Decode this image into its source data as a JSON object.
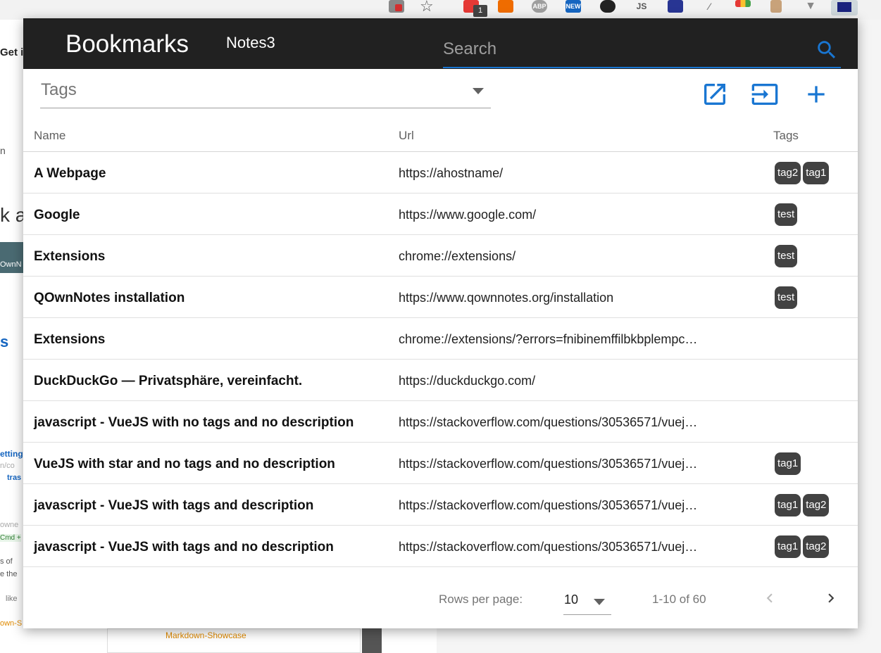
{
  "browser": {
    "extensions": [
      {
        "icon": "blocked-shield-extension-icon",
        "label": ""
      },
      {
        "icon": "star-bookmark-icon",
        "label": ""
      },
      {
        "icon": "calendar-extension-icon",
        "label": "1"
      },
      {
        "icon": "orange-squares-extension-icon",
        "label": ""
      },
      {
        "icon": "adblock-extension-icon",
        "label": "ABP"
      },
      {
        "icon": "news-extension-icon",
        "label": "NEW"
      },
      {
        "icon": "paw-extension-icon",
        "label": ""
      },
      {
        "icon": "gear-js-extension-icon",
        "label": "JS"
      },
      {
        "icon": "cloud-extension-icon",
        "label": ""
      },
      {
        "icon": "magic-wand-extension-icon",
        "label": ""
      },
      {
        "icon": "color-dots-extension-icon",
        "label": ""
      },
      {
        "icon": "cursor-extension-icon",
        "label": ""
      },
      {
        "icon": "funnel-extension-icon",
        "label": ""
      },
      {
        "icon": "flag-extension-icon",
        "label": ""
      }
    ]
  },
  "background_page": {
    "fragments": [
      "Get i",
      "n",
      "k a",
      "OwnN",
      "s",
      "etting",
      "n/co",
      "tras",
      "owne",
      "Cmd +",
      "s of",
      "e the",
      "like",
      "own-S"
    ],
    "bottom_card_text": "Markdown-Showcase"
  },
  "toolbar": {
    "title": "Bookmarks",
    "subtitle": "Notes3",
    "search_placeholder": "Search"
  },
  "filters": {
    "tags_label": "Tags"
  },
  "actions": {
    "open_all": "open-in-new-icon",
    "import": "import-icon",
    "add": "add-icon"
  },
  "table": {
    "headers": {
      "name": "Name",
      "url": "Url",
      "tags": "Tags"
    },
    "rows": [
      {
        "name": "A Webpage",
        "url": "https://ahostname/",
        "tags": [
          "tag2",
          "tag1"
        ]
      },
      {
        "name": "Google",
        "url": "https://www.google.com/",
        "tags": [
          "test"
        ]
      },
      {
        "name": "Extensions",
        "url": "chrome://extensions/",
        "tags": [
          "test"
        ]
      },
      {
        "name": "QOwnNotes installation",
        "url": "https://www.qownnotes.org/installation",
        "tags": [
          "test"
        ]
      },
      {
        "name": "Extensions",
        "url": "chrome://extensions/?errors=fnibinemffilbkbplempc…",
        "tags": []
      },
      {
        "name": "DuckDuckGo — Privatsphäre, vereinfacht.",
        "url": "https://duckduckgo.com/",
        "tags": []
      },
      {
        "name": "javascript - VueJS with no tags and no description",
        "url": "https://stackoverflow.com/questions/30536571/vuej…",
        "tags": []
      },
      {
        "name": "VueJS with star and no tags and no description",
        "url": "https://stackoverflow.com/questions/30536571/vuej…",
        "tags": [
          "tag1"
        ]
      },
      {
        "name": "javascript - VueJS with tags and description",
        "url": "https://stackoverflow.com/questions/30536571/vuej…",
        "tags": [
          "tag1",
          "tag2"
        ]
      },
      {
        "name": "javascript - VueJS with tags and no description",
        "url": "https://stackoverflow.com/questions/30536571/vuej…",
        "tags": [
          "tag1",
          "tag2"
        ]
      }
    ]
  },
  "pagination": {
    "rows_per_page_label": "Rows per page:",
    "rows_per_page_value": "10",
    "range_text": "1-10 of 60"
  },
  "colors": {
    "toolbar_bg": "#212121",
    "accent": "#1976d2",
    "chip_bg": "#424242"
  }
}
